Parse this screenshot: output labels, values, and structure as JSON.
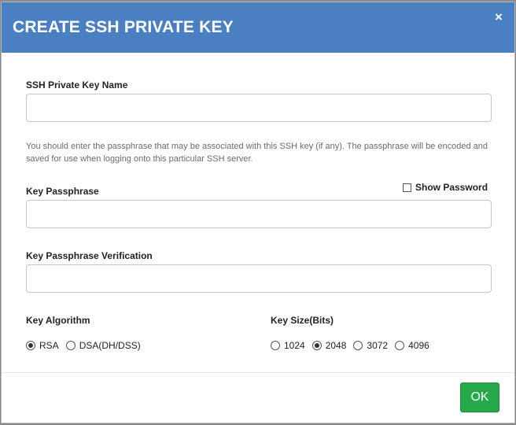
{
  "dialog": {
    "title": "CREATE SSH PRIVATE KEY",
    "close_label": "×"
  },
  "form": {
    "key_name": {
      "label": "SSH Private Key Name",
      "value": ""
    },
    "help_text": "You should enter the passphrase that may be associated with this SSH key (if any). The passphrase will be encoded and saved for use when logging onto this particular SSH server.",
    "passphrase": {
      "label": "Key Passphrase",
      "value": ""
    },
    "show_password": {
      "label": "Show Password",
      "checked": false
    },
    "passphrase_verify": {
      "label": "Key Passphrase Verification",
      "value": ""
    },
    "algorithm": {
      "label": "Key Algorithm",
      "options": [
        {
          "label": "RSA",
          "selected": true
        },
        {
          "label": "DSA(DH/DSS)",
          "selected": false
        }
      ]
    },
    "key_size": {
      "label": "Key Size(Bits)",
      "options": [
        {
          "label": "1024",
          "selected": false
        },
        {
          "label": "2048",
          "selected": true
        },
        {
          "label": "3072",
          "selected": false
        },
        {
          "label": "4096",
          "selected": false
        }
      ]
    }
  },
  "footer": {
    "ok_label": "OK"
  },
  "colors": {
    "header": "#4a7fc1",
    "ok_button": "#27a84a"
  }
}
